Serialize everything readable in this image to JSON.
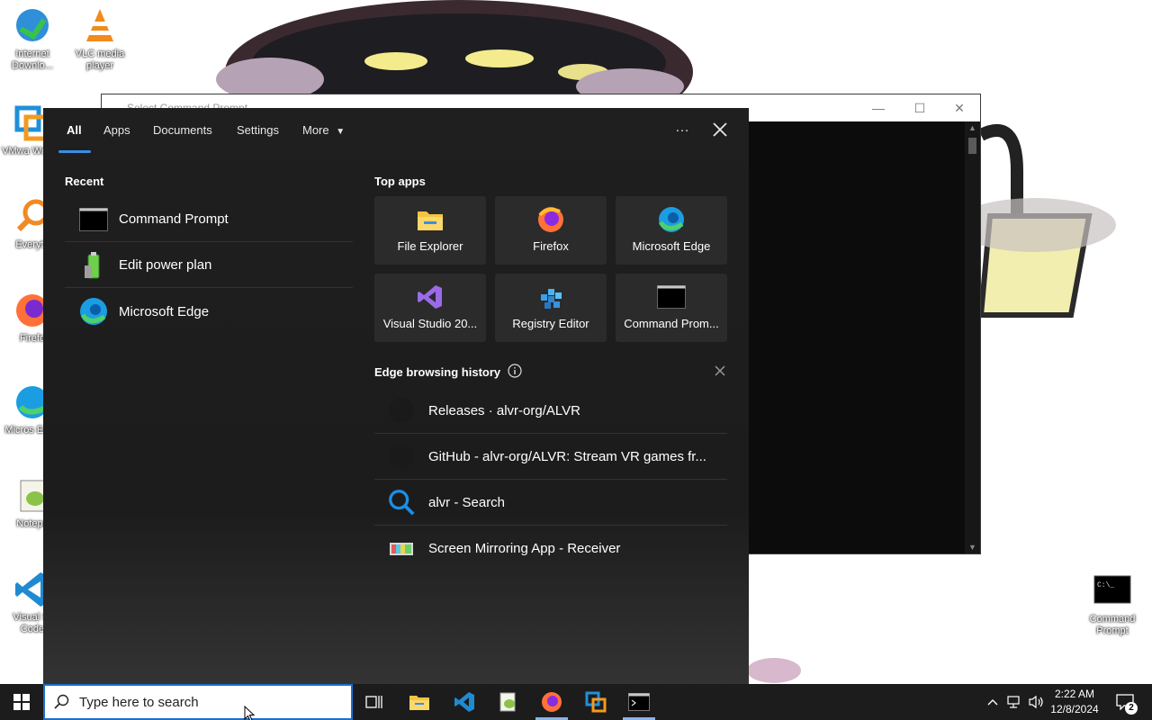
{
  "desktop": {
    "icons": [
      {
        "label": "Internet Downlo...",
        "icon": "internet-download-manager-icon"
      },
      {
        "label": "VLC media player",
        "icon": "vlc-icon"
      },
      {
        "label": "VMwa Workst",
        "icon": "vmware-icon"
      },
      {
        "label": "Everyth",
        "icon": "everything-search-icon"
      },
      {
        "label": "Firefo",
        "icon": "firefox-icon"
      },
      {
        "label": "Micros Edge",
        "icon": "edge-icon"
      },
      {
        "label": "Notepa",
        "icon": "notepad-plus-plus-icon"
      },
      {
        "label": "Visual St Code",
        "icon": "vscode-icon"
      },
      {
        "label": "Command Prompt",
        "icon": "cmd-icon"
      }
    ]
  },
  "cmd_window": {
    "title": "Select Command Prompt",
    "minimize": "—",
    "maximize": "☐",
    "close": "✕"
  },
  "search": {
    "tabs": [
      {
        "label": "All",
        "active": true
      },
      {
        "label": "Apps"
      },
      {
        "label": "Documents"
      },
      {
        "label": "Settings"
      },
      {
        "label": "More"
      }
    ],
    "more_menu_icon": "…",
    "recent_heading": "Recent",
    "recent": [
      {
        "label": "Command Prompt",
        "icon": "cmd-icon"
      },
      {
        "label": "Edit power plan",
        "icon": "battery-icon"
      },
      {
        "label": "Microsoft Edge",
        "icon": "edge-icon"
      }
    ],
    "top_apps_heading": "Top apps",
    "top_apps": [
      {
        "label": "File Explorer",
        "icon": "folder-icon"
      },
      {
        "label": "Firefox",
        "icon": "firefox-icon"
      },
      {
        "label": "Microsoft Edge",
        "icon": "edge-icon"
      },
      {
        "label": "Visual Studio 20...",
        "icon": "visual-studio-icon"
      },
      {
        "label": "Registry Editor",
        "icon": "registry-icon"
      },
      {
        "label": "Command Prom...",
        "icon": "cmd-icon"
      }
    ],
    "history_heading": "Edge browsing history",
    "history": [
      {
        "label": "Releases · alvr-org/ALVR",
        "icon": "github-icon"
      },
      {
        "label": "GitHub - alvr-org/ALVR: Stream VR games fr...",
        "icon": "github-icon"
      },
      {
        "label": "alvr - Search",
        "icon": "search-icon"
      },
      {
        "label": "Screen Mirroring App - Receiver",
        "icon": "mirroring-icon"
      }
    ]
  },
  "taskbar": {
    "search_placeholder": "Type here to search",
    "time": "2:22 AM",
    "date": "12/8/2024",
    "notification_count": "2"
  }
}
